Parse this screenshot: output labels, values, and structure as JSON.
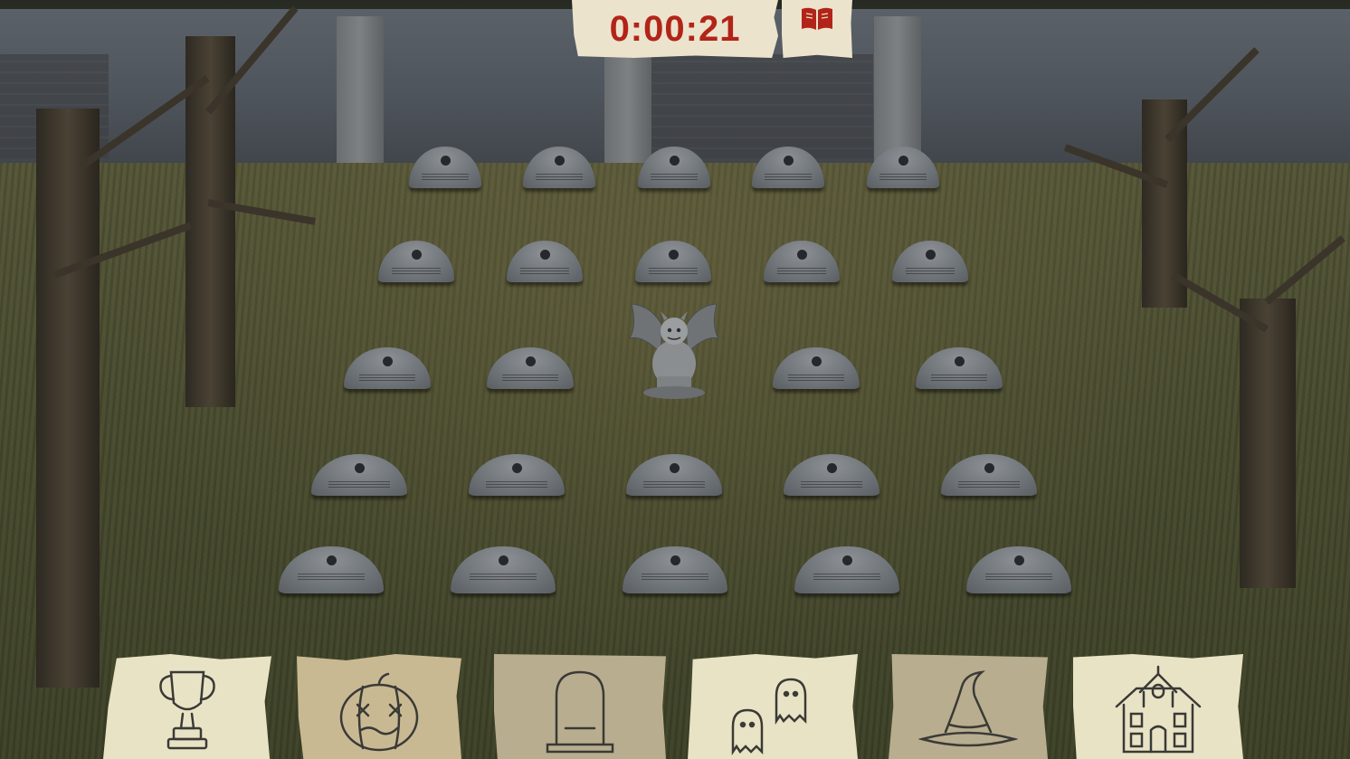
{
  "hud": {
    "timer": "0:00:21",
    "rules_book_icon": "open-book-icon",
    "accent_color": "#b22418"
  },
  "board": {
    "rows": [
      5,
      5,
      5,
      5,
      5
    ],
    "special_piece": "gargoyle-statue"
  },
  "tabs": [
    {
      "name": "trophy",
      "icon": "trophy-icon"
    },
    {
      "name": "pumpkin",
      "icon": "jack-o-lantern-icon"
    },
    {
      "name": "tombstone",
      "icon": "tombstone-icon"
    },
    {
      "name": "ghosts",
      "icon": "ghosts-icon"
    },
    {
      "name": "witch-hat",
      "icon": "witch-hat-icon"
    },
    {
      "name": "haunted-house",
      "icon": "haunted-house-icon"
    }
  ]
}
